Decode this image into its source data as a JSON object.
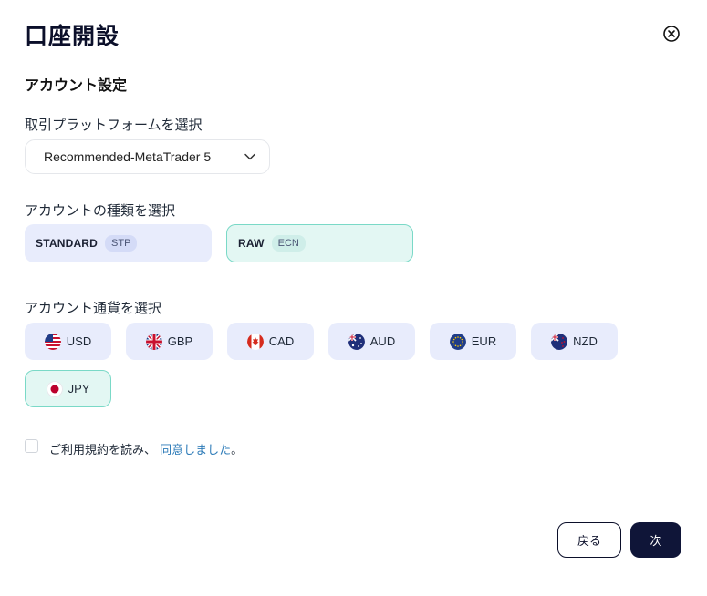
{
  "dialog": {
    "title": "口座開設",
    "section_title": "アカウント設定"
  },
  "platform": {
    "label": "取引プラットフォームを選択",
    "selected": "Recommended-MetaTrader 5"
  },
  "account_type": {
    "label": "アカウントの種類を選択",
    "options": [
      {
        "name": "STANDARD",
        "badge": "STP"
      },
      {
        "name": "RAW",
        "badge": "ECN"
      }
    ],
    "selected": "RAW"
  },
  "currency": {
    "label": "アカウント通貨を選択",
    "options": [
      "USD",
      "GBP",
      "CAD",
      "AUD",
      "EUR",
      "NZD",
      "JPY"
    ],
    "selected": "JPY"
  },
  "terms": {
    "text": "ご利用規約を読み、",
    "link": "同意しました",
    "suffix": "。"
  },
  "buttons": {
    "back": "戻る",
    "next": "次"
  },
  "colors": {
    "accent_dark": "#0f1538",
    "card_bg": "#e8ecfc",
    "selected_bg": "#e3f7f3",
    "selected_border": "#7ad9c7",
    "link": "#2d7bb8"
  }
}
